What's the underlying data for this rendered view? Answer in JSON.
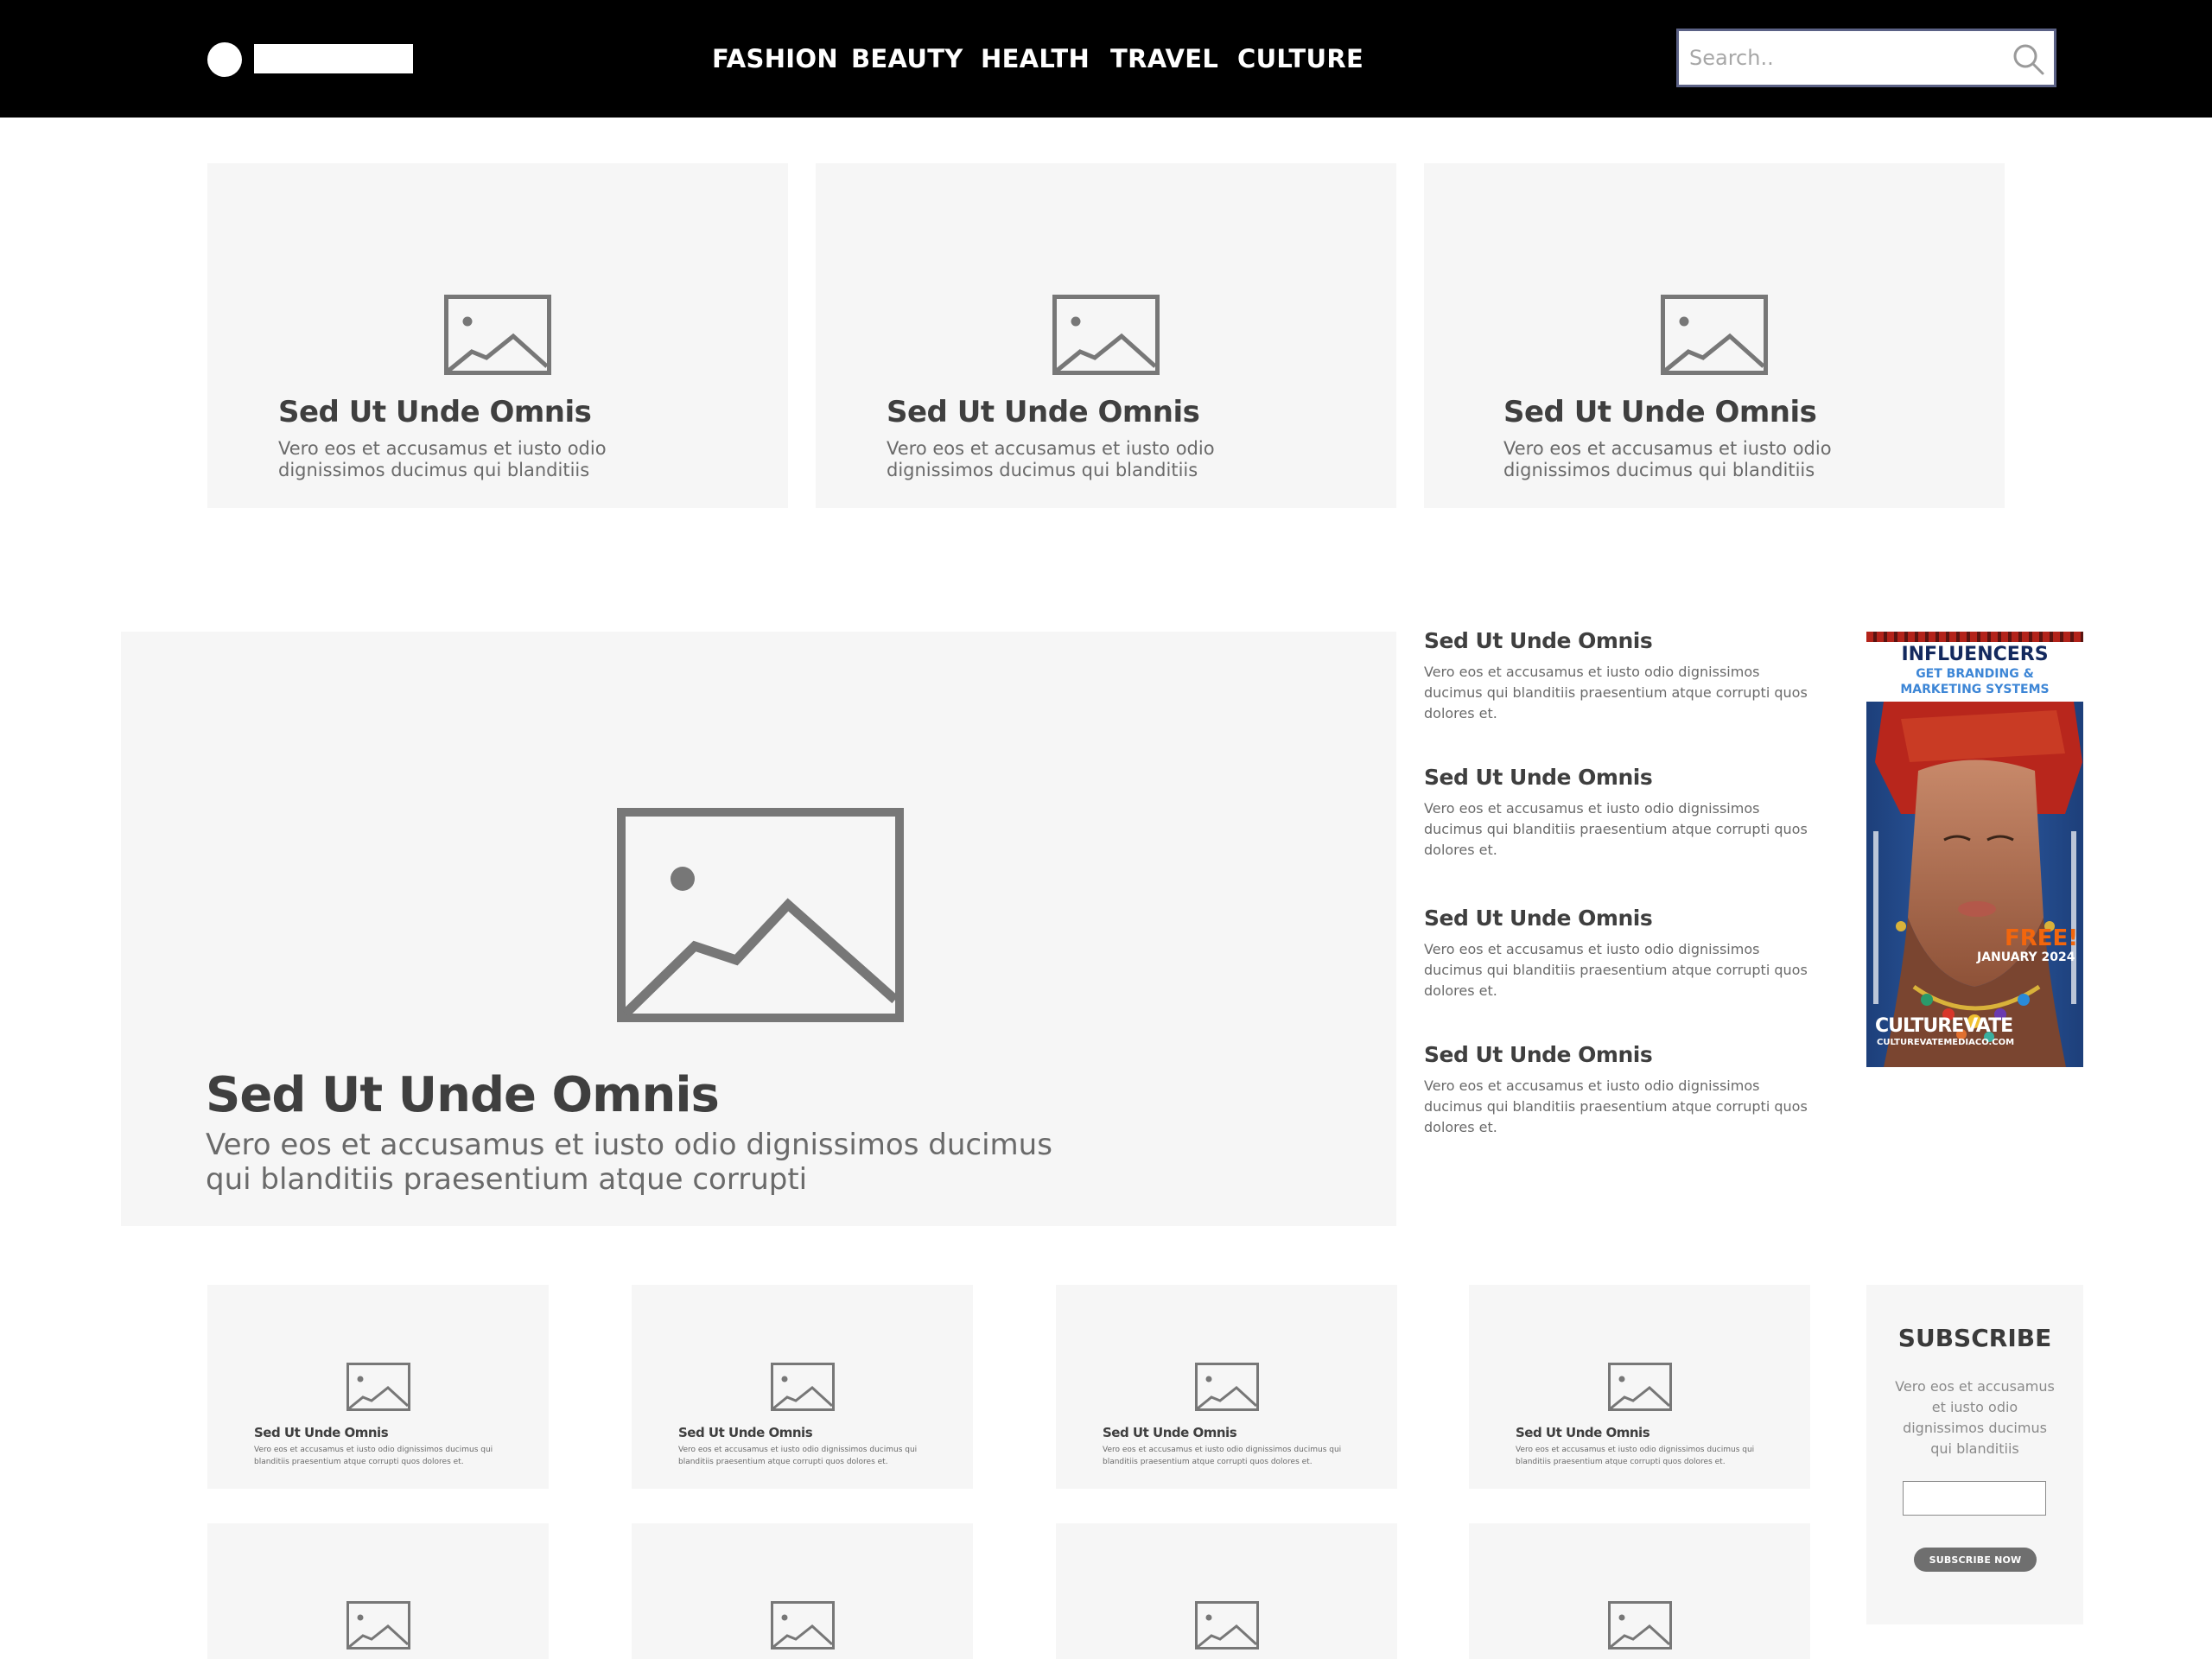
{
  "header": {
    "nav": [
      "FASHION",
      "BEAUTY",
      "HEALTH",
      "TRAVEL",
      "CULTURE"
    ],
    "search_placeholder": "Search.."
  },
  "top_cards": [
    {
      "title": "Sed Ut Unde Omnis",
      "desc": "Vero eos et accusamus et iusto odio dignissimos ducimus qui blanditiis"
    },
    {
      "title": "Sed Ut Unde Omnis",
      "desc": "Vero eos et accusamus et iusto odio dignissimos ducimus qui blanditiis"
    },
    {
      "title": "Sed Ut Unde Omnis",
      "desc": "Vero eos et accusamus et iusto odio dignissimos ducimus qui blanditiis"
    }
  ],
  "hero": {
    "title": "Sed Ut Unde Omnis",
    "desc": "Vero eos et accusamus et iusto odio dignissimos ducimus qui blanditiis praesentium atque corrupti"
  },
  "list": [
    {
      "title": "Sed Ut Unde Omnis",
      "desc": "Vero eos et accusamus et iusto odio dignissimos ducimus qui blanditiis praesentium atque corrupti quos dolores et."
    },
    {
      "title": "Sed Ut Unde Omnis",
      "desc": "Vero eos et accusamus et iusto odio dignissimos ducimus qui blanditiis praesentium atque corrupti quos dolores et."
    },
    {
      "title": "Sed Ut Unde Omnis",
      "desc": "Vero eos et accusamus et iusto odio dignissimos ducimus qui blanditiis praesentium atque corrupti quos dolores et."
    },
    {
      "title": "Sed Ut Unde Omnis",
      "desc": "Vero eos et accusamus et iusto odio dignissimos ducimus qui blanditiis praesentium atque corrupti quos dolores et."
    }
  ],
  "ad": {
    "title": "INFLUENCERS",
    "subtitle": "GET BRANDING & MARKETING SYSTEMS",
    "free": "FREE!",
    "date": "JANUARY 2024",
    "brand": "CULTUREVATE",
    "url": "CULTUREVATEMEDIACO.COM"
  },
  "small_cards": [
    {
      "title": "Sed Ut Unde Omnis",
      "desc": "Vero eos et accusamus et iusto odio dignissimos ducimus qui blanditiis praesentium atque corrupti quos dolores et."
    },
    {
      "title": "Sed Ut Unde Omnis",
      "desc": "Vero eos et accusamus et iusto odio dignissimos ducimus qui blanditiis praesentium atque corrupti quos dolores et."
    },
    {
      "title": "Sed Ut Unde Omnis",
      "desc": "Vero eos et accusamus et iusto odio dignissimos ducimus qui blanditiis praesentium atque corrupti quos dolores et."
    },
    {
      "title": "Sed Ut Unde Omnis",
      "desc": "Vero eos et accusamus et iusto odio dignissimos ducimus qui blanditiis praesentium atque corrupti quos dolores et."
    }
  ],
  "subscribe": {
    "title": "SUBSCRIBE",
    "desc": "Vero eos et accusamus et iusto odio dignissimos ducimus qui blanditiis",
    "button": "SUBSCRIBE NOW"
  },
  "icons": {
    "search": "search-icon",
    "placeholder": "image-placeholder-icon"
  },
  "colors": {
    "header_bg": "#000000",
    "card_bg": "#f6f6f6",
    "text_dark": "#3f3f3f",
    "text_muted": "#6a6a6a",
    "search_border": "#5b6185",
    "button_bg": "#6f6f6f"
  }
}
